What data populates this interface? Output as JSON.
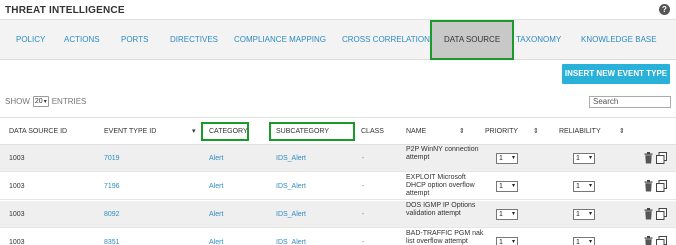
{
  "header": {
    "title": "THREAT INTELLIGENCE",
    "help": "?"
  },
  "tabs": [
    {
      "label": "POLICY"
    },
    {
      "label": "ACTIONS"
    },
    {
      "label": "PORTS"
    },
    {
      "label": "DIRECTIVES"
    },
    {
      "label": "COMPLIANCE MAPPING"
    },
    {
      "label": "CROSS CORRELATION"
    },
    {
      "label": "DATA SOURCE",
      "active": true
    },
    {
      "label": "TAXONOMY"
    },
    {
      "label": "KNOWLEDGE BASE"
    }
  ],
  "toolbar": {
    "insert_label": "INSERT NEW EVENT TYPE",
    "show_label": "SHOW",
    "show_value": "20",
    "entries_label": "ENTRIES",
    "search_placeholder": "Search"
  },
  "columns": {
    "data_source_id": "DATA SOURCE ID",
    "event_type_id": "EVENT TYPE ID",
    "category": "CATEGORY",
    "subcategory": "SUBCATEGORY",
    "class": "CLASS",
    "name": "NAME",
    "priority": "PRIORITY",
    "reliability": "RELIABILITY"
  },
  "rows": [
    {
      "data_source_id": "1003",
      "event_type_id": "7019",
      "category": "Alert",
      "subcategory": "IDS_Alert",
      "class": "-",
      "name": "P2P WinNY connection attempt",
      "priority": "1",
      "reliability": "1"
    },
    {
      "data_source_id": "1003",
      "event_type_id": "7196",
      "category": "Alert",
      "subcategory": "IDS_Alert",
      "class": "-",
      "name": "EXPLOIT Microsoft DHCP option overflow attempt",
      "priority": "1",
      "reliability": "1"
    },
    {
      "data_source_id": "1003",
      "event_type_id": "8092",
      "category": "Alert",
      "subcategory": "IDS_Alert",
      "class": "-",
      "name": "DOS IGMP IP Options validation attempt",
      "priority": "1",
      "reliability": "1"
    },
    {
      "data_source_id": "1003",
      "event_type_id": "8351",
      "category": "Alert",
      "subcategory": "IDS_Alert",
      "class": "-",
      "name": "BAD-TRAFFIC PGM nak list overflow attempt",
      "priority": "1",
      "reliability": "1"
    }
  ],
  "colors": {
    "accent": "#2ab1d9",
    "link": "#2d8cc2",
    "highlight_box": "#1a9a2c"
  }
}
